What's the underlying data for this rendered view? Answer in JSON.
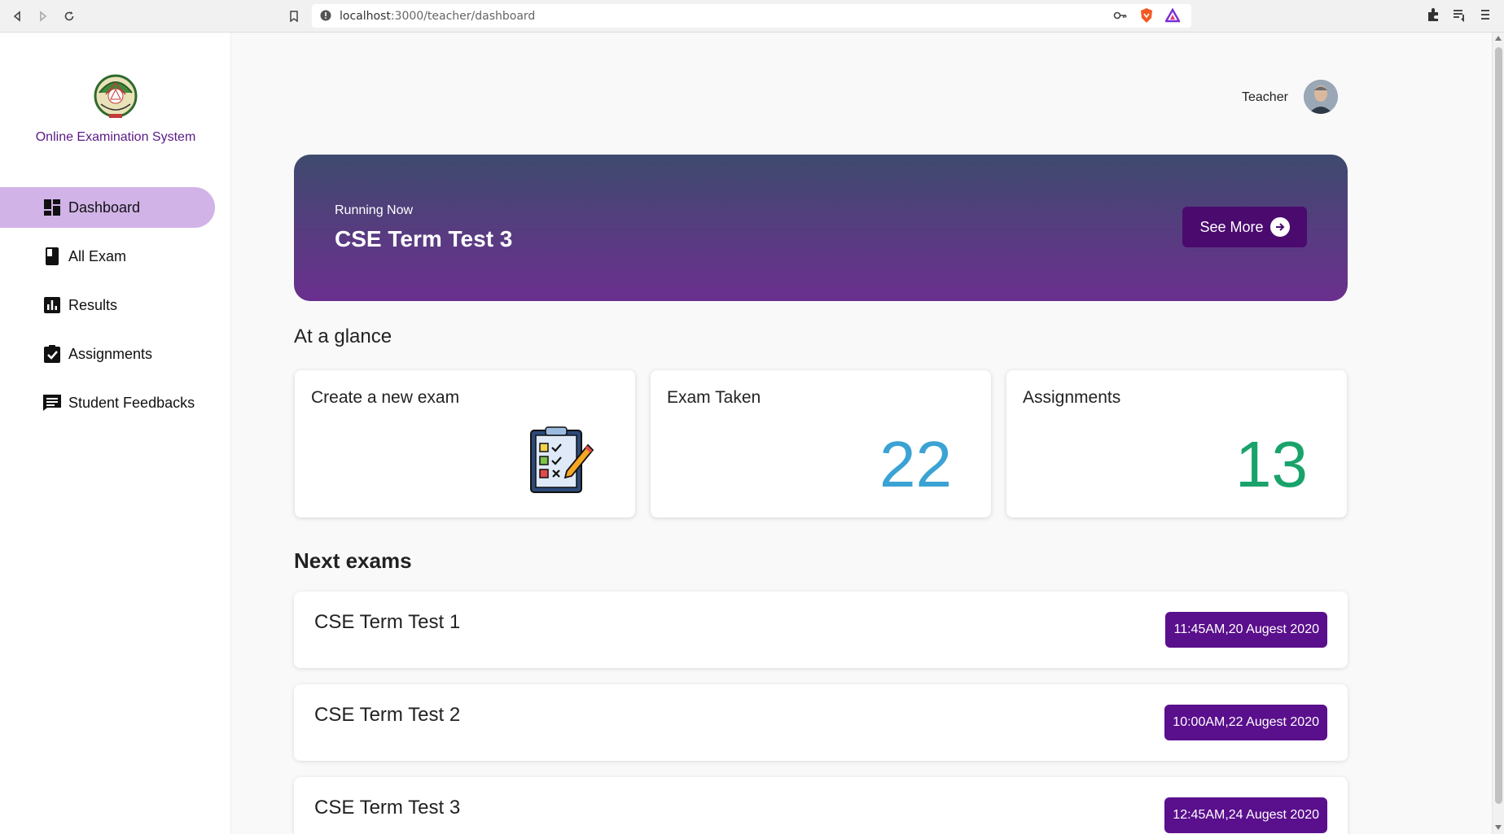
{
  "browser": {
    "url_host": "localhost",
    "url_path": ":3000/teacher/dashboard"
  },
  "sidebar": {
    "brand": "Online Examination System",
    "items": [
      {
        "label": "Dashboard",
        "icon": "dashboard-icon",
        "active": true
      },
      {
        "label": "All Exam",
        "icon": "book-icon",
        "active": false
      },
      {
        "label": "Results",
        "icon": "bar-chart-icon",
        "active": false
      },
      {
        "label": "Assignments",
        "icon": "clipboard-check-icon",
        "active": false
      },
      {
        "label": "Student Feedbacks",
        "icon": "feedback-icon",
        "active": false
      }
    ]
  },
  "header": {
    "user_role": "Teacher"
  },
  "banner": {
    "subtitle": "Running Now",
    "title": "CSE Term Test 3",
    "button_label": "See More"
  },
  "glance": {
    "title": "At a glance",
    "cards": [
      {
        "title": "Create a new exam",
        "icon": "checklist-pencil-icon"
      },
      {
        "title": "Exam Taken",
        "value": "22",
        "color": "#3ba3d4"
      },
      {
        "title": "Assignments",
        "value": "13",
        "color": "#19a36b"
      }
    ]
  },
  "next_exams": {
    "title": "Next exams",
    "items": [
      {
        "name": "CSE Term Test 1",
        "time": "11:45AM,20 Augest 2020"
      },
      {
        "name": "CSE Term Test 2",
        "time": "10:00AM,22 Augest 2020"
      },
      {
        "name": "CSE Term Test 3",
        "time": "12:45AM,24 Augest 2020"
      }
    ]
  },
  "colors": {
    "accent": "#5a0f8c",
    "sidebar_active": "#d1b3e8"
  }
}
